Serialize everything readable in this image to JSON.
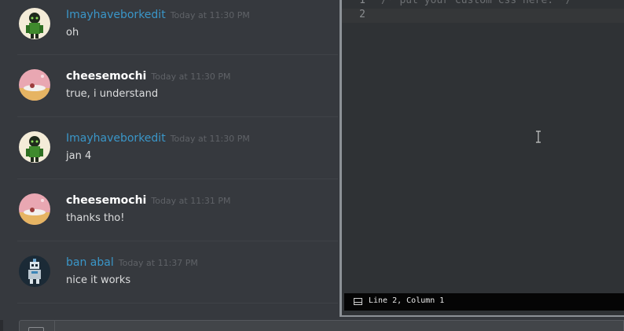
{
  "messages": [
    {
      "username": "Imayhaveborkedit",
      "username_color": "#3a96c8",
      "timestamp": "Today at 11:30 PM",
      "text": "oh",
      "avatar": "green-character-avatar"
    },
    {
      "username": "cheesemochi",
      "username_color": "#ffffff",
      "timestamp": "Today at 11:30 PM",
      "text": "true, i understand",
      "avatar": "pink-sky-avatar"
    },
    {
      "username": "Imayhaveborkedit",
      "username_color": "#3a96c8",
      "timestamp": "Today at 11:30 PM",
      "text": "jan 4",
      "avatar": "green-character-avatar"
    },
    {
      "username": "cheesemochi",
      "username_color": "#ffffff",
      "timestamp": "Today at 11:31 PM",
      "text": "thanks tho!",
      "avatar": "pink-sky-avatar"
    },
    {
      "username": "ban abal",
      "username_color": "#3a96c8",
      "timestamp": "Today at 11:37 PM",
      "text": "nice it works",
      "avatar": "pixel-robot-avatar"
    }
  ],
  "editor": {
    "lines": [
      {
        "number": "1",
        "code": "/* put your custom css here. */"
      },
      {
        "number": "2",
        "code": ""
      }
    ],
    "status": "Line 2, Column 1"
  },
  "colors": {
    "background": "#36393e",
    "link_blue": "#3a96c8",
    "editor_bg": "#2f3235",
    "status_bg": "#050505"
  }
}
